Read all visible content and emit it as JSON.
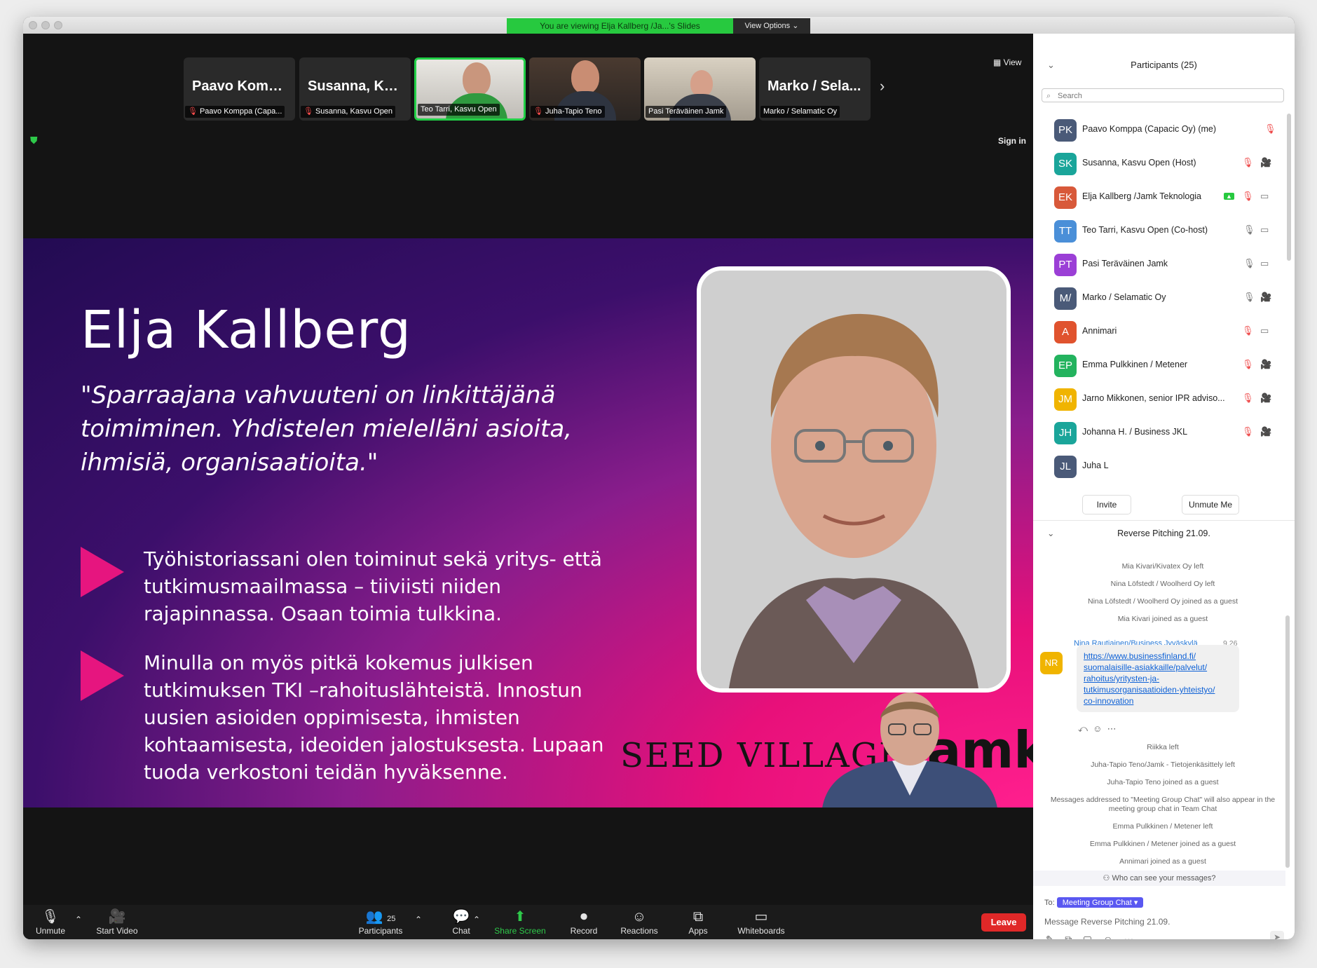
{
  "banner": {
    "viewing": "You are viewing Elja Kallberg /Ja...'s Slides",
    "view_options": "View Options"
  },
  "top_right": {
    "view": "View",
    "sign_in": "Sign in"
  },
  "thumbnails": [
    {
      "big": "Paavo Kompp...",
      "caption": "Paavo Komppa (Capa...",
      "muted": true
    },
    {
      "big": "Susanna, Kas...",
      "caption": "Susanna, Kasvu Open",
      "muted": true
    },
    {
      "big": "",
      "caption": "Teo Tarri, Kasvu Open",
      "muted": false
    },
    {
      "big": "",
      "caption": "Juha-Tapio Teno",
      "muted": true
    },
    {
      "big": "",
      "caption": "Pasi Teräväinen Jamk",
      "muted": false
    },
    {
      "big": "Marko / Sela...",
      "caption": "Marko / Selamatic Oy",
      "muted": false
    }
  ],
  "slide": {
    "name": "Elja Kallberg",
    "quote": "\"Sparraajana vahvuuteni on linkittäjänä toimiminen. Yhdistelen mielelläni asioita, ihmisiä, organisaatioita.\"",
    "bullet1": "Työhistoriassani olen toiminut sekä yritys- että tutkimusmaailmassa – tiiviisti niiden rajapinnassa. Osaan toimia tulkkina.",
    "bullet2": "Minulla on myös pitkä kokemus julkisen tutkimuksen TKI –rahoituslähteistä. Innostun uusien asioiden oppimisesta, ihmisten kohtaamisesta, ideoiden jalostuksesta. Lupaan tuoda verkostoni teidän hyväksenne.",
    "logo_seed": "SEED VILLAGE",
    "logo_jamk": "jamk"
  },
  "toolbar": {
    "unmute": "Unmute",
    "start_video": "Start Video",
    "participants": "Participants",
    "participants_count": "25",
    "chat": "Chat",
    "share_screen": "Share Screen",
    "record": "Record",
    "reactions": "Reactions",
    "apps": "Apps",
    "whiteboards": "Whiteboards",
    "leave": "Leave"
  },
  "participants_panel": {
    "title": "Participants (25)",
    "search_placeholder": "Search",
    "invite": "Invite",
    "unmute_me": "Unmute Me",
    "list": [
      {
        "initials": "PK",
        "name": "Paavo Komppa (Capacic Oy) (me)",
        "color": "#4a5a78"
      },
      {
        "initials": "SK",
        "name": "Susanna, Kasvu Open (Host)",
        "color": "#1aa59a"
      },
      {
        "initials": "EK",
        "name": "Elja Kallberg /Jamk Teknologia",
        "color": "#d8593a"
      },
      {
        "initials": "TT",
        "name": "Teo Tarri, Kasvu Open (Co-host)",
        "color": "#4a8fd8"
      },
      {
        "initials": "PT",
        "name": "Pasi Teräväinen Jamk",
        "color": "#9b3fd6"
      },
      {
        "initials": "M/",
        "name": "Marko / Selamatic Oy",
        "color": "#4a5a78"
      },
      {
        "initials": "A",
        "name": "Annimari",
        "color": "#e0532e"
      },
      {
        "initials": "EP",
        "name": "Emma Pulkkinen / Metener",
        "color": "#23b35e"
      },
      {
        "initials": "JM",
        "name": "Jarno Mikkonen, senior IPR adviso...",
        "color": "#f0b400"
      },
      {
        "initials": "JH",
        "name": "Johanna H. / Business JKL",
        "color": "#1aa59a"
      },
      {
        "initials": "JL",
        "name": "Juha L",
        "color": "#4a5a78"
      }
    ]
  },
  "chat_panel": {
    "title": "Reverse Pitching 21.09.",
    "system_top": [
      "Mia Kivari/Kivatex Oy left",
      "Nina Löfstedt / Woolherd Oy left",
      "Nina Löfstedt / Woolherd Oy joined as a guest",
      "Mia Kivari joined as a guest"
    ],
    "message": {
      "initials": "NR",
      "sender": "Nina Rautiainen/Business Jyväskylä",
      "time": "9.26",
      "link": "https://www.businessfinland.fi/suomalaisille-asiakkaille/palvelut/rahoitus/yritysten-ja-tutkimusorganisaatioiden-yhteistyo/co-innovation",
      "link_lines": [
        "https://www.businessfinland.fi/",
        "suomalaisille-asiakkaille/palvelut/",
        "rahoitus/yritysten-ja-",
        "tutkimusorganisaatioiden-yhteistyo/",
        "co-innovation"
      ]
    },
    "system_bottom": [
      "Riikka left",
      "Juha-Tapio Teno/Jamk - Tietojenkäsittely left",
      "Juha-Tapio Teno joined as a guest",
      "Messages addressed to \"Meeting Group Chat\" will also appear in the meeting group chat in Team Chat",
      "Emma Pulkkinen / Metener left",
      "Emma Pulkkinen / Metener joined as a guest",
      "Annimari joined as a guest"
    ],
    "who_can_see": "Who can see your messages?",
    "to_label": "To:",
    "recipient": "Meeting Group Chat",
    "input_placeholder": "Message Reverse Pitching 21.09."
  }
}
